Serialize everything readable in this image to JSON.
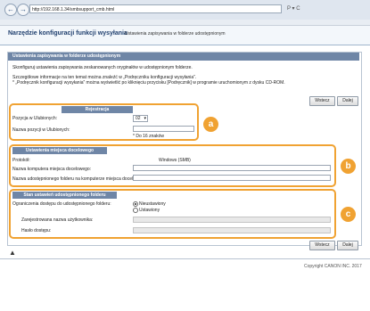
{
  "browser": {
    "url": "http://192.168.1.34/smbsupport_cmb.html",
    "search_label": "P ▾ C"
  },
  "header": {
    "app_title": "Narzędzie konfiguracji funkcji wysyłania",
    "page_subtitle": "Ustawienia zapisywania w folderze udostępnionym"
  },
  "panel": {
    "title": "Ustawienia zapisywania w folderze udostępnionym",
    "description_1": "Skonfiguruj ustawienia zapisywania zeskanowanych oryginałów w udostępnionym folderze.",
    "description_2": "Szczegółowe informacje na ten temat można znaleźć w „Podręczniku konfiguracji wysyłania”.",
    "description_3": "* „Podręcznik konfiguracji wysyłania” można wyświetlić po kliknięciu przycisku [Podręcznik] w programie uruchomionym z dysku CD-ROM.",
    "manual_button": "Wstecz",
    "next_button": "Dalej"
  },
  "registration": {
    "title": "Rejestracja",
    "position_label": "Pozycja w Ulubionych:",
    "position_value": "02",
    "name_label": "Nazwa pozycji w Ulubionych:",
    "name_value": "",
    "name_hint": "* Do 16 znaków"
  },
  "destination": {
    "title": "Ustawienia miejsca docelowego",
    "protocol_label": "Protokół:",
    "protocol_value": "Windows (SMB)",
    "computer_label": "Nazwa komputera miejsca docelowego:",
    "computer_value": "",
    "folder_label": "Nazwa udostępnionego folderu na komputerze miejsca docelowego:",
    "folder_value": ""
  },
  "shared_folder": {
    "title": "Stan ustawień udostępnionego folderu",
    "restrict_label": "Ograniczenia dostępu do udostępnionego folderu:",
    "option_unset": "Nieustawiony",
    "option_set": "Ustawiony",
    "username_label": "Zarejestrowana nazwa użytkownika:",
    "username_value": "",
    "password_label": "Hasło dostępu:",
    "password_value": ""
  },
  "footer_buttons": {
    "back": "Wstecz",
    "next": "Dalej"
  },
  "badges": [
    "a",
    "b",
    "c"
  ],
  "copyright": "Copyright CANON INC. 2017",
  "colors": {
    "accent": "#f0a232",
    "section_header": "#6f86a6",
    "title_text": "#1f3f6e"
  }
}
